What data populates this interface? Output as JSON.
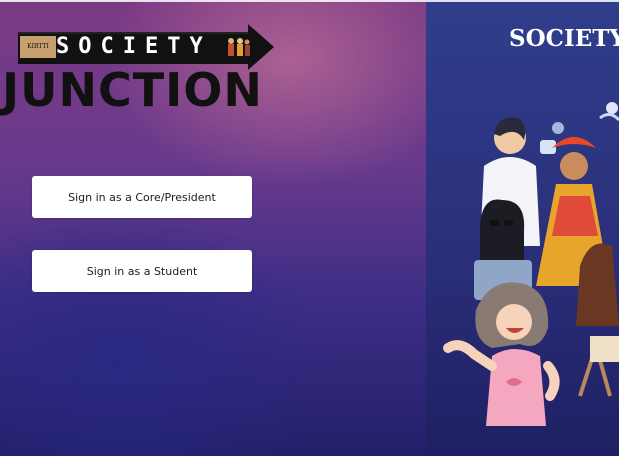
{
  "logo": {
    "society_text": "SOCIETY",
    "junction_text": "JUNCTION",
    "tag_text": "KIRTTI"
  },
  "buttons": {
    "core_label": "Sign in as a Core/President",
    "student_label": "Sign in as a Student"
  },
  "hero": {
    "title": "SOCIETY"
  },
  "colors": {
    "button_bg": "#ffffff",
    "button_text": "#1c1c1c",
    "bg_top": "#7b3a84",
    "bg_bottom": "#22206a",
    "panel": "#2f3e8c"
  },
  "icons": {
    "logo_arrow": "arrow-right-icon",
    "illustration": "people-illustration"
  }
}
